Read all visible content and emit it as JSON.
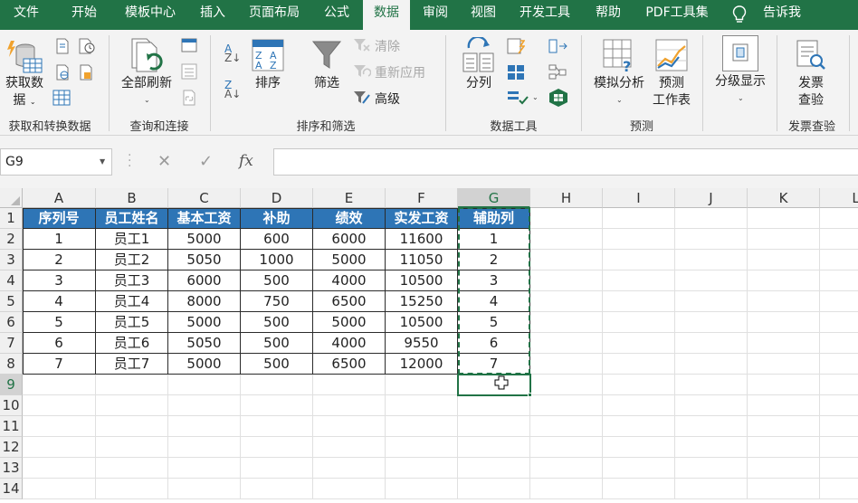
{
  "tabs": [
    "文件",
    "开始",
    "模板中心",
    "插入",
    "页面布局",
    "公式",
    "数据",
    "审阅",
    "视图",
    "开发工具",
    "帮助",
    "PDF工具集",
    "告诉我"
  ],
  "active_tab": "数据",
  "ribbon": {
    "get_data": {
      "label_line1": "获取数",
      "label_line2": "据"
    },
    "refresh_all": "全部刷新",
    "sort": "排序",
    "filter": "筛选",
    "clear": "清除",
    "reapply": "重新应用",
    "advanced": "高级",
    "text_to_columns": "分列",
    "what_if": "模拟分析",
    "forecast_line1": "预测",
    "forecast_line2": "工作表",
    "outline": "分级显示",
    "invoice_line1": "发票",
    "invoice_line2": "查验",
    "groups": [
      "获取和转换数据",
      "查询和连接",
      "排序和筛选",
      "数据工具",
      "预测",
      "发票查验"
    ]
  },
  "formula_bar": {
    "name_box": "G9",
    "fx": "fx",
    "value": ""
  },
  "columns": [
    "A",
    "B",
    "C",
    "D",
    "E",
    "F",
    "G",
    "H",
    "I",
    "J",
    "K",
    "L"
  ],
  "rows": [
    "1",
    "2",
    "3",
    "4",
    "5",
    "6",
    "7",
    "8",
    "9",
    "10",
    "11",
    "12",
    "13",
    "14"
  ],
  "table": {
    "headers": [
      "序列号",
      "员工姓名",
      "基本工资",
      "补助",
      "绩效",
      "实发工资",
      "辅助列"
    ],
    "rows": [
      [
        "1",
        "员工1",
        "5000",
        "600",
        "6000",
        "11600",
        "1"
      ],
      [
        "2",
        "员工2",
        "5050",
        "1000",
        "5000",
        "11050",
        "2"
      ],
      [
        "3",
        "员工3",
        "6000",
        "500",
        "4000",
        "10500",
        "3"
      ],
      [
        "4",
        "员工4",
        "8000",
        "750",
        "6500",
        "15250",
        "4"
      ],
      [
        "5",
        "员工5",
        "5000",
        "500",
        "5000",
        "10500",
        "5"
      ],
      [
        "6",
        "员工6",
        "5050",
        "500",
        "4000",
        "9550",
        "6"
      ],
      [
        "7",
        "员工7",
        "5000",
        "500",
        "6500",
        "12000",
        "7"
      ]
    ]
  },
  "selection": {
    "active_cell": "G9",
    "copy_range": "G1:G8"
  },
  "colors": {
    "accent": "#217346",
    "header_fill": "#2e75b6",
    "header_text": "#ffffff"
  },
  "icons": [
    "get-data-icon",
    "refresh-icon",
    "sort-az-icon",
    "sort-za-icon",
    "sort-icon",
    "filter-icon",
    "clear-filter-icon",
    "reapply-icon",
    "advanced-filter-icon",
    "text-to-columns-icon",
    "what-if-icon",
    "forecast-icon",
    "outline-icon",
    "invoice-check-icon",
    "lightbulb-icon",
    "cancel-icon",
    "enter-icon",
    "function-icon",
    "cross-cursor-icon"
  ]
}
